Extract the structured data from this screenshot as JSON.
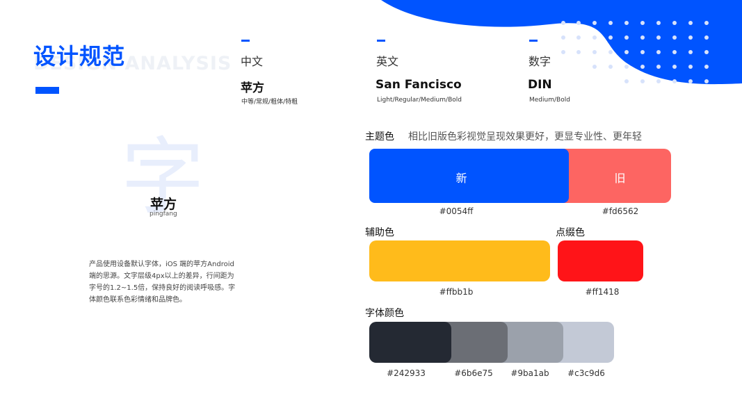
{
  "header": {
    "title": "设计规范",
    "title_en": "DESIGN ANALYSIS"
  },
  "font_columns": [
    {
      "heading": "中文",
      "font_name": "苹方",
      "weights": "中等/常规/粗体/特粗"
    },
    {
      "heading": "英文",
      "font_name": "San Fancisco",
      "weights": "Light/Regular/Medium/Bold"
    },
    {
      "heading": "数字",
      "font_name": "DIN",
      "weights": "Medium/Bold"
    }
  ],
  "sample": {
    "glyph": "字",
    "name": "苹方",
    "subtitle": "pingfang"
  },
  "description": "产品使用设备默认字体，iOS 端的苹方Android端的思源。文字层级4px以上的差异，行间距为字号的1.2~1.5倍，保持良好的阅读呼吸感。字体颜色联系色彩情绪和品牌色。",
  "theme": {
    "label": "主题色",
    "note": "相比旧版色彩视觉呈现效果更好，更显专业性、更年轻",
    "new_label": "新",
    "old_label": "旧",
    "new_color": "#0054ff",
    "old_color": "#fd6562",
    "new_hex": "#0054ff",
    "old_hex": "#fd6562"
  },
  "auxiliary": {
    "label": "辅助色",
    "color": "#ffbb1b",
    "hex": "#ffbb1b"
  },
  "accent": {
    "label": "点缀色",
    "color": "#ff1418",
    "hex": "#ff1418"
  },
  "text_colors": {
    "label": "字体颜色",
    "swatches": [
      {
        "color": "#242933",
        "hex": "#242933"
      },
      {
        "color": "#6b6e75",
        "hex": "#6b6e75"
      },
      {
        "color": "#9ba1ab",
        "hex": "#9ba1ab"
      },
      {
        "color": "#c3c9d6",
        "hex": "#c3c9d6"
      }
    ]
  },
  "decor": {
    "brand_blue": "#0054ff",
    "dot_color": "#d7e2fb"
  }
}
